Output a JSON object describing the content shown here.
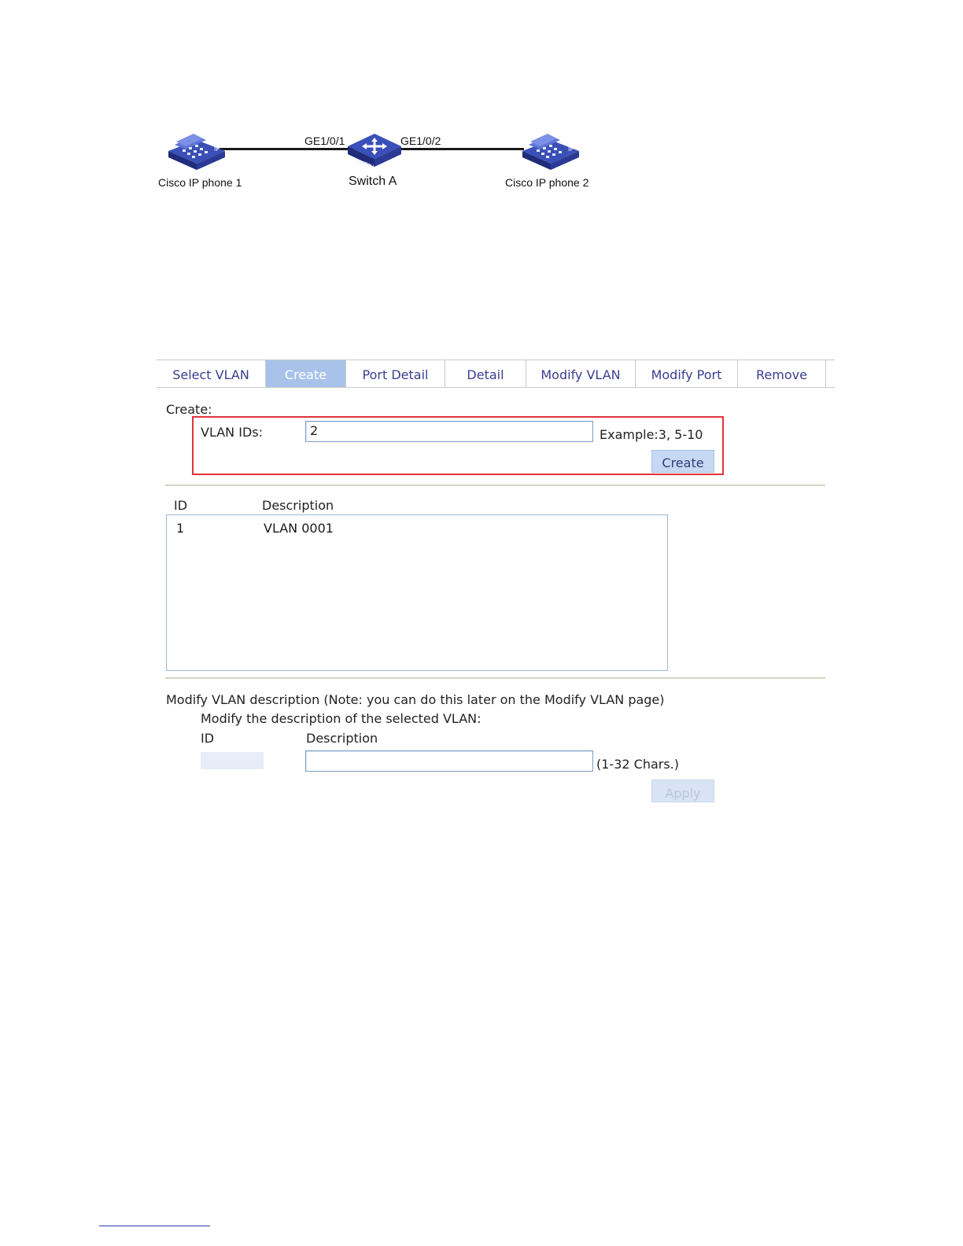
{
  "diagram": {
    "devices": [
      {
        "label": "Cisco IP phone 1",
        "icon": "ip-phone-icon"
      },
      {
        "label": "Switch A",
        "icon": "switch-icon"
      },
      {
        "label": "Cisco IP phone 2",
        "icon": "ip-phone-icon"
      }
    ],
    "ports": [
      "GE1/0/1",
      "GE1/0/2"
    ]
  },
  "tabs": [
    {
      "label": "Select VLAN",
      "active": false
    },
    {
      "label": "Create",
      "active": true
    },
    {
      "label": "Port Detail",
      "active": false
    },
    {
      "label": "Detail",
      "active": false
    },
    {
      "label": "Modify VLAN",
      "active": false
    },
    {
      "label": "Modify Port",
      "active": false
    },
    {
      "label": "Remove",
      "active": false
    }
  ],
  "create": {
    "section_label": "Create:",
    "vlan_ids_label": "VLAN IDs:",
    "vlan_ids_value": "2",
    "example_text": "Example:3, 5-10",
    "create_button": "Create"
  },
  "vlan_list": {
    "headers": {
      "id": "ID",
      "description": "Description"
    },
    "rows": [
      {
        "id": "1",
        "description": "VLAN 0001"
      }
    ]
  },
  "modify": {
    "section_label": "Modify VLAN description (Note: you can do this later on the Modify VLAN page)",
    "sub_label": "Modify the description of the selected VLAN:",
    "id_header": "ID",
    "description_header": "Description",
    "description_value": "",
    "chars_hint": "(1-32 Chars.)",
    "apply_button": "Apply"
  },
  "colors": {
    "active_tab": "#a9c2ea",
    "tab_text": "#3a3f8f",
    "highlight_box": "#e0333a",
    "button": "#c6d8f2"
  }
}
